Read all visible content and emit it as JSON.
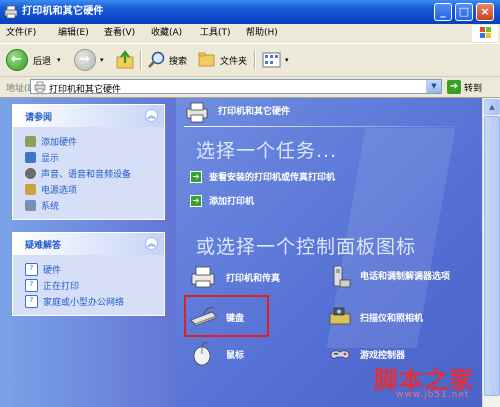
{
  "window": {
    "title": "打印机和其它硬件",
    "min_label": "_",
    "max_label": "□",
    "close_label": "×"
  },
  "menu": {
    "file": "文件(F)",
    "edit": "编辑(E)",
    "view": "查看(V)",
    "favorites": "收藏(A)",
    "tools": "工具(T)",
    "help": "帮助(H)"
  },
  "toolbar": {
    "back": "后退",
    "search": "搜索",
    "folders": "文件夹"
  },
  "address": {
    "label": "地址(D)",
    "value": "打印机和其它硬件",
    "go": "转到"
  },
  "see_also": {
    "title": "请参阅",
    "items": [
      {
        "label": "添加硬件",
        "icon": "add-hardware-icon"
      },
      {
        "label": "显示",
        "icon": "display-icon"
      },
      {
        "label": "声音、语音和音频设备",
        "icon": "sound-icon"
      },
      {
        "label": "电源选项",
        "icon": "power-options-icon"
      },
      {
        "label": "系统",
        "icon": "system-icon"
      }
    ]
  },
  "troubleshoot": {
    "title": "疑难解答",
    "items": [
      {
        "label": "硬件",
        "icon": "help-icon"
      },
      {
        "label": "正在打印",
        "icon": "help-icon"
      },
      {
        "label": "家庭或小型办公网络",
        "icon": "help-icon"
      }
    ]
  },
  "main": {
    "header": "打印机和其它硬件",
    "task_heading": "选择一个任务...",
    "tasks": [
      "查看安装的打印机或传真打印机",
      "添加打印机"
    ],
    "cp_heading": "或选择一个控制面板图标",
    "icons": [
      {
        "label": "打印机和传真",
        "icon": "printer-icon"
      },
      {
        "label": "电话和调制解调器选项",
        "icon": "phone-modem-icon"
      },
      {
        "label": "键盘",
        "icon": "keyboard-icon"
      },
      {
        "label": "扫描仪和照相机",
        "icon": "scanner-camera-icon"
      },
      {
        "label": "鼠标",
        "icon": "mouse-icon"
      },
      {
        "label": "游戏控制器",
        "icon": "game-controller-icon"
      }
    ]
  },
  "watermark": {
    "cn": "脚本之家",
    "url": "www.jb51.net"
  },
  "colors": {
    "titlebar": "#0b4bd1",
    "link": "#215dc6",
    "pane": "#5470d5",
    "highlight": "#e02020"
  }
}
